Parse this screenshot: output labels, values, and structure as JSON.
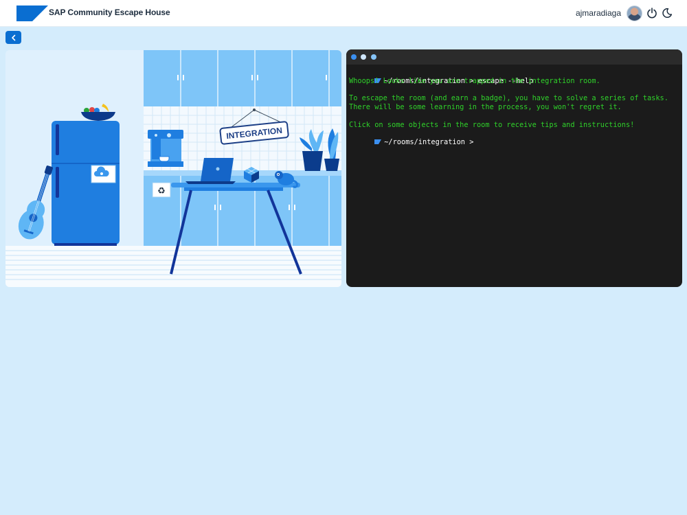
{
  "header": {
    "title": "SAP Community Escape House",
    "username": "ajmaradiaga",
    "icons": [
      "power-icon",
      "moon-icon"
    ]
  },
  "room": {
    "sign": "INTEGRATION"
  },
  "terminal": {
    "prompt": "~/rooms/integration >",
    "command": "escape --help",
    "lines": [
      "Whoops! Looks like you are trapped in the integration room.",
      "To escape the room (and earn a badge), you have to solve a series of tasks.",
      "There will be some learning in the process, you won't regret it.",
      "Click on some objects in the room to receive tips and instructions!"
    ],
    "prompt2": "~/rooms/integration >"
  },
  "colors": {
    "accent": "#0a6ed1",
    "background": "#d4ecfc",
    "terminal_bg": "#1b1b1b",
    "terminal_text": "#2fd12a"
  }
}
